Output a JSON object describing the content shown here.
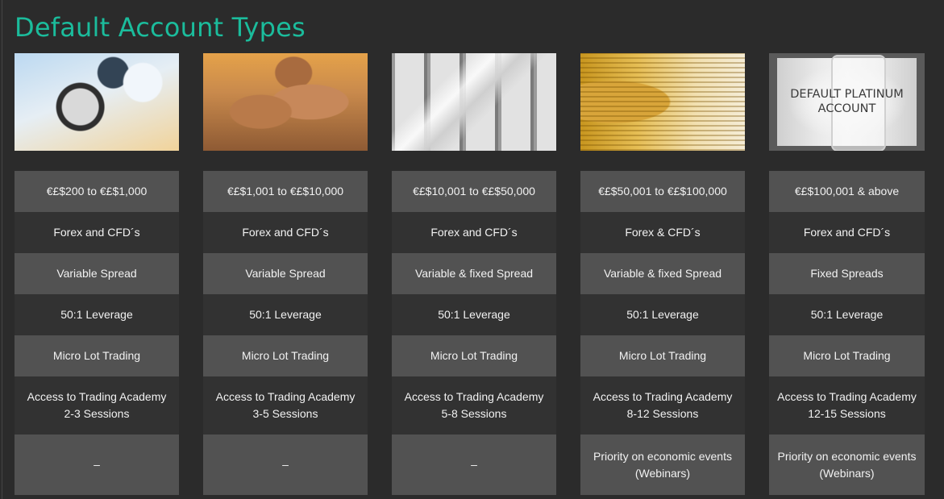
{
  "page": {
    "title": "Default Account Types"
  },
  "accounts": [
    {
      "image": "magnifying-glass-coins-image",
      "image_label": "",
      "deposit": "€£$200 to €£$1,000",
      "instruments": "Forex and CFD´s",
      "spread": "Variable Spread",
      "leverage": "50:1 Leverage",
      "lot": "Micro Lot Trading",
      "academy": "Access to Trading Academy\n2-3 Sessions",
      "priority": "–"
    },
    {
      "image": "copper-coin-stacks-image",
      "image_label": "",
      "deposit": "€£$1,001 to €£$10,000",
      "instruments": "Forex and CFD´s",
      "spread": "Variable Spread",
      "leverage": "50:1 Leverage",
      "lot": "Micro Lot Trading",
      "academy": "Access to Trading Academy\n3-5 Sessions",
      "priority": "–"
    },
    {
      "image": "silver-bars-image",
      "image_label": "",
      "deposit": "€£$10,001 to €£$50,000",
      "instruments": "Forex and CFD´s",
      "spread": "Variable & fixed Spread",
      "leverage": "50:1 Leverage",
      "lot": "Micro Lot Trading",
      "academy": "Access to Trading Academy\n5-8 Sessions",
      "priority": "–"
    },
    {
      "image": "gold-coins-dollar-bills-image",
      "image_label": "",
      "deposit": "€£$50,001 to €£$100,000",
      "instruments": "Forex & CFD´s",
      "spread": "Variable & fixed Spread",
      "leverage": "50:1 Leverage",
      "lot": "Micro Lot Trading",
      "academy": "Access to Trading Academy\n8-12 Sessions",
      "priority": "Priority on economic events\n(Webinars)"
    },
    {
      "image": "platinum-bars-image",
      "image_label": "DEFAULT PLATINUM\nACCOUNT",
      "deposit": "€£$100,001 & above",
      "instruments": "Forex and CFD´s",
      "spread": "Fixed Spreads",
      "leverage": "50:1 Leverage",
      "lot": "Micro Lot Trading",
      "academy": "Access to Trading Academy\n12-15 Sessions",
      "priority": "Priority on economic events\n(Webinars)"
    }
  ],
  "colors": {
    "accent": "#1bbc9c",
    "background": "#2b2b2b",
    "cell_light": "#525252",
    "cell_dark": "#323232"
  }
}
